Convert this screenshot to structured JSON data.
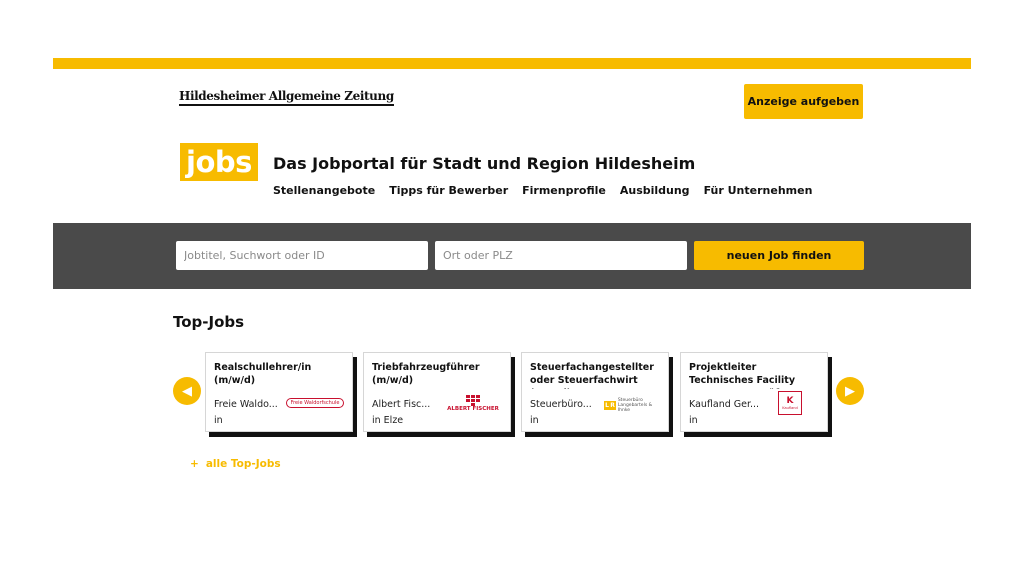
{
  "header": {
    "masthead": "Hildesheimer Allgemeine Zeitung",
    "ad_button": "Anzeige aufgeben",
    "logo_text": "jobs",
    "portal_title": "Das Jobportal für Stadt und Region Hildesheim"
  },
  "nav": [
    "Stellenangebote",
    "Tipps für Bewerber",
    "Firmenprofile",
    "Ausbildung",
    "Für Unternehmen"
  ],
  "search": {
    "job_placeholder": "Jobtitel, Suchwort oder ID",
    "location_placeholder": "Ort oder PLZ",
    "button": "neuen Job finden"
  },
  "top_jobs": {
    "title": "Top-Jobs",
    "all_link": "alle Top-Jobs",
    "cards": [
      {
        "title": "Realschullehrer/in (m/w/d)",
        "company": "Freie Waldo...",
        "location": "in",
        "logo": "Freie Waldorfschule"
      },
      {
        "title": "Triebfahrzeugführer (m/w/d)",
        "company": "Albert Fisc...",
        "location": "in Elze",
        "logo": "ALBERT FISCHER"
      },
      {
        "title": "Steuerfachangestellter oder Steuerfachwirt (m/w/d)",
        "company": "Steuerbüro...",
        "location": "in",
        "logo": "Steuerbüro Langebartels & Ihnke"
      },
      {
        "title": "Projektleiter Technisches Facility Management Lüftun...",
        "company": "Kaufland Ger...",
        "location": "in",
        "logo": "Kaufland"
      }
    ]
  },
  "colors": {
    "accent": "#f7bb00",
    "band": "#4a4a4a"
  }
}
